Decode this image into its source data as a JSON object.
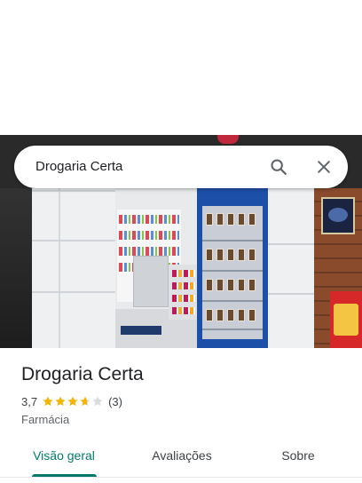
{
  "search": {
    "query": "Drogaria Certa",
    "search_icon": "search-icon",
    "close_icon": "close-icon"
  },
  "place": {
    "name": "Drogaria Certa",
    "rating": "3,7",
    "rating_fraction": 0.74,
    "review_count": "(3)",
    "category": "Farmácia"
  },
  "tabs": [
    {
      "label": "Visão geral",
      "active": true
    },
    {
      "label": "Avaliações",
      "active": false
    },
    {
      "label": "Sobre",
      "active": false
    }
  ],
  "colors": {
    "accent": "#00796b",
    "star": "#f4b400",
    "star_empty": "#dadce0"
  }
}
